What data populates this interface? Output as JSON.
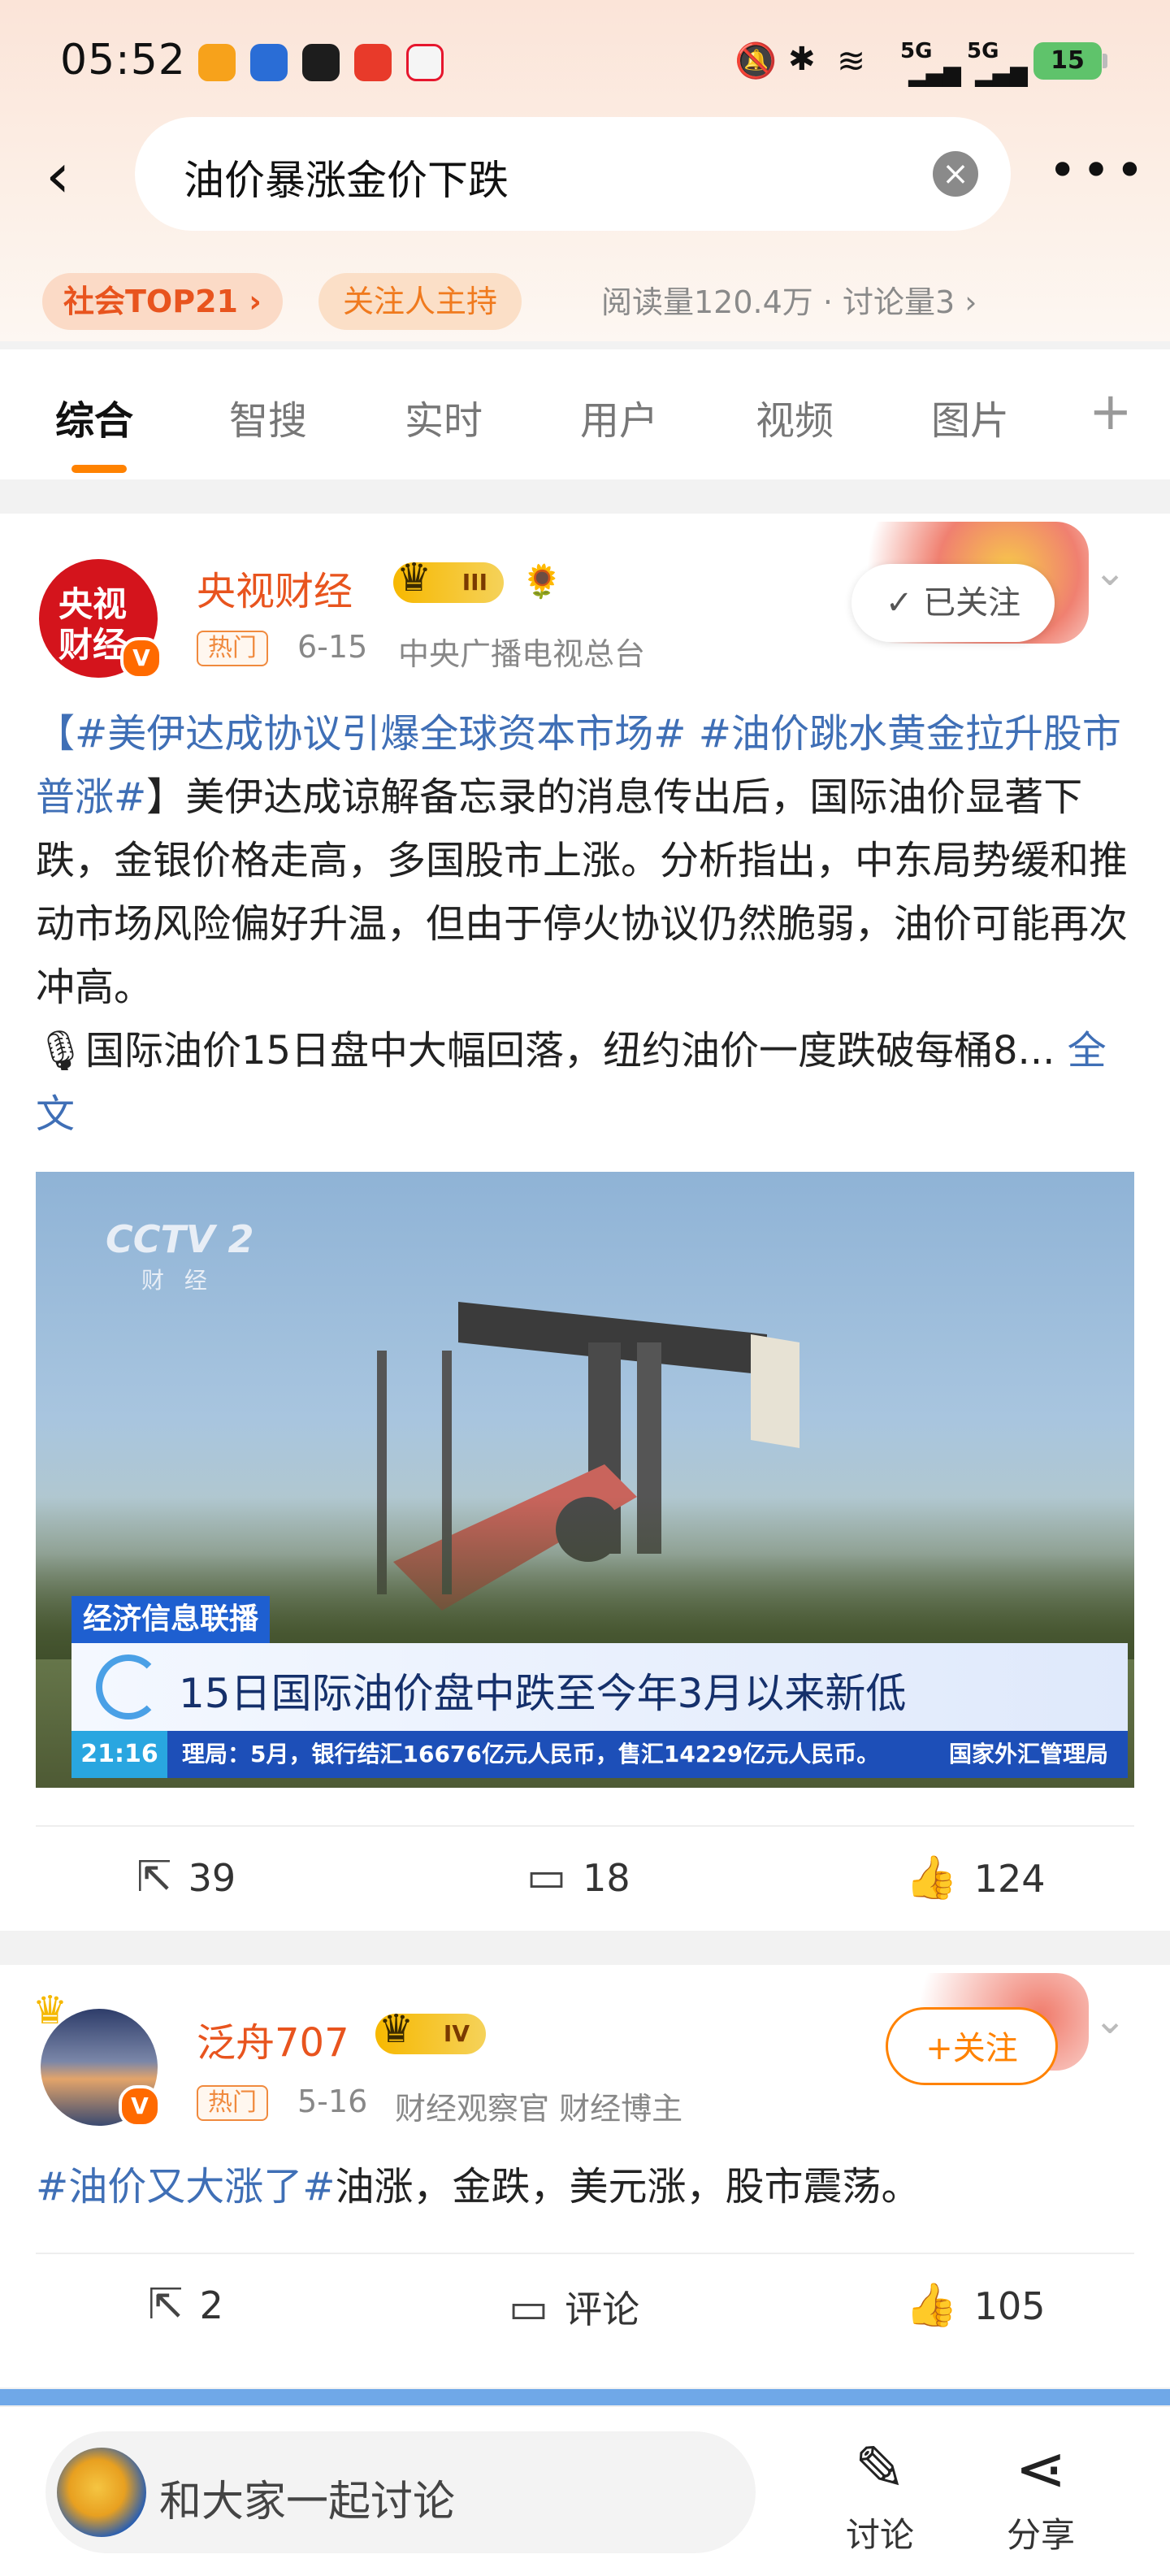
{
  "status_bar": {
    "time": "05:52",
    "battery": "15",
    "network_1": "5G",
    "network_2": "5G",
    "icons": [
      "bell-off-icon",
      "bluetooth-icon",
      "wifi-icon",
      "signal-icon",
      "signal-icon"
    ]
  },
  "search": {
    "query": "油价暴涨金价下跌",
    "back_icon": "‹",
    "clear_icon": "×",
    "more_icon": "•••"
  },
  "topic": {
    "rank_tag": "社会TOP21",
    "rank_chevron": "›",
    "follow_host": "关注人主持",
    "stats": "阅读量120.4万 · 讨论量3",
    "stats_chevron": "›"
  },
  "tabs": [
    "综合",
    "智搜",
    "实时",
    "用户",
    "视频",
    "图片"
  ],
  "tabs_more": "+",
  "post1": {
    "author": "央视财经",
    "level": "III",
    "avatar_text_1": "央视",
    "avatar_text_2": "财经",
    "verified": "V",
    "hot": "热门",
    "date": "6-15",
    "source": "中央广播电视总台",
    "follow_state": "✓ 已关注",
    "chevron": "⌄",
    "text_hash1": "【#美伊达成协议引爆全球资本市场# #油价跳水黄金拉升股市普涨#",
    "text_main": "】美伊达成谅解备忘录的消息传出后，国际油价显著下跌，金银价格走高，多国股市上涨。分析指出，中东局势缓和推动市场风险偏好升温，但由于停火协议仍然脆弱，油价可能再次冲高。",
    "text_sub": "🎙国际油价15日盘中大幅回落，纽约油价一度跌破每桶8...",
    "full_text": "全文",
    "video": {
      "channel_logo": "CCTV 2",
      "channel_sub": "财 经",
      "tag": "经济信息联播",
      "headline": "15日国际油价盘中跌至今年3月以来新低",
      "ticker_time": "21:16",
      "ticker_msg": "理局：5月，银行结汇16676亿元人民币，售汇14229亿元人民币。",
      "ticker_src": "国家外汇管理局"
    },
    "reposts": "39",
    "comments": "18",
    "likes": "124"
  },
  "post2": {
    "author": "泛舟707",
    "level": "IV",
    "verified": "V",
    "hot": "热门",
    "date": "5-16",
    "source": "财经观察官 财经博主",
    "follow_btn": "+关注",
    "chevron": "⌄",
    "hashtag": "#油价又大涨了#",
    "text": "油涨，金跌，美元涨，股市震荡。",
    "reposts": "2",
    "comments": "评论",
    "likes": "105"
  },
  "bottom_bar": {
    "placeholder": "和大家一起讨论",
    "discuss_label": "讨论",
    "share_label": "分享"
  },
  "colors": {
    "accent_orange": "#ff8200",
    "username": "#e8541e",
    "link": "#3f6fb6"
  }
}
